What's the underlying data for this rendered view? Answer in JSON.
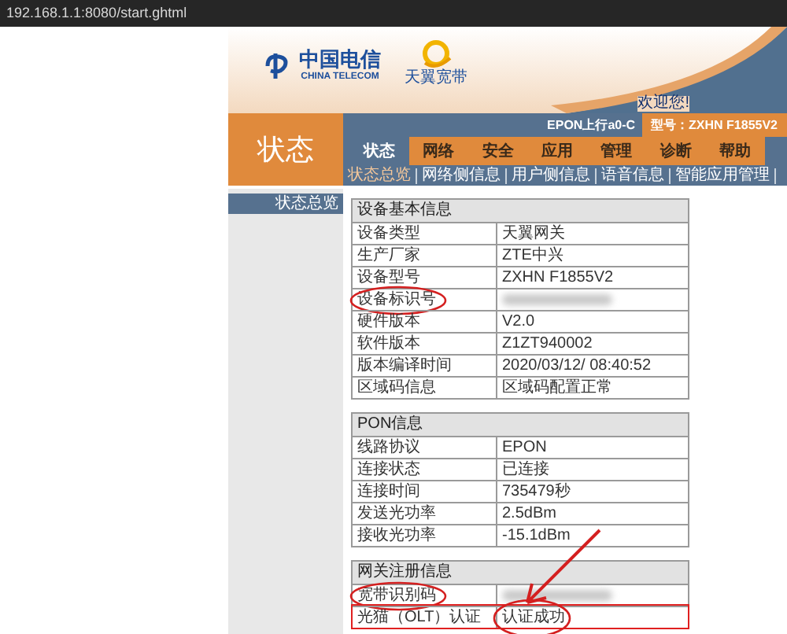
{
  "browser": {
    "url": "192.168.1.1:8080/start.ghtml"
  },
  "header": {
    "brand_cn": "中国电信",
    "brand_en": "CHINA TELECOM",
    "product": "天翼宽带",
    "welcome": "欢迎您!"
  },
  "page_title": "状态",
  "info_bar": {
    "uplink": "EPON上行a0-C",
    "model": "型号：ZXHN F1855V2"
  },
  "tabs": [
    {
      "label": "状态",
      "selected": true
    },
    {
      "label": "网络",
      "selected": false
    },
    {
      "label": "安全",
      "selected": false
    },
    {
      "label": "应用",
      "selected": false
    },
    {
      "label": "管理",
      "selected": false
    },
    {
      "label": "诊断",
      "selected": false
    },
    {
      "label": "帮助",
      "selected": false
    }
  ],
  "subnav": [
    {
      "label": "状态总览",
      "selected": true
    },
    {
      "label": "网络侧信息",
      "selected": false
    },
    {
      "label": "用户侧信息",
      "selected": false
    },
    {
      "label": "语音信息",
      "selected": false
    },
    {
      "label": "智能应用管理",
      "selected": false
    }
  ],
  "sidebar": {
    "items": [
      {
        "label": "状态总览",
        "selected": true
      }
    ]
  },
  "tables": [
    {
      "title": "设备基本信息",
      "rows": [
        {
          "kind": "text",
          "label": "设备类型",
          "value": "天翼网关",
          "label_circled": false,
          "value_circled": false,
          "boxed": false
        },
        {
          "kind": "text",
          "label": "生产厂家",
          "value": "ZTE中兴",
          "label_circled": false,
          "value_circled": false,
          "boxed": false
        },
        {
          "kind": "text",
          "label": "设备型号",
          "value": "ZXHN  F1855V2",
          "label_circled": false,
          "value_circled": false,
          "boxed": false
        },
        {
          "kind": "redacted",
          "label": "设备标识号",
          "label_circled": true,
          "value_circled": false,
          "boxed": false
        },
        {
          "kind": "text",
          "label": "硬件版本",
          "value": "V2.0",
          "label_circled": false,
          "value_circled": false,
          "boxed": false
        },
        {
          "kind": "text",
          "label": "软件版本",
          "value": "Z1ZT940002",
          "label_circled": false,
          "value_circled": false,
          "boxed": false
        },
        {
          "kind": "text",
          "label": "版本编译时间",
          "value": "2020/03/12/  08:40:52",
          "label_circled": false,
          "value_circled": false,
          "boxed": false
        },
        {
          "kind": "text",
          "label": "区域码信息",
          "value": "区域码配置正常",
          "label_circled": false,
          "value_circled": false,
          "boxed": false
        }
      ]
    },
    {
      "title": "PON信息",
      "rows": [
        {
          "kind": "text",
          "label": "线路协议",
          "value": "EPON",
          "label_circled": false,
          "value_circled": false,
          "boxed": false
        },
        {
          "kind": "text",
          "label": "连接状态",
          "value": "已连接",
          "label_circled": false,
          "value_circled": false,
          "boxed": false
        },
        {
          "kind": "text",
          "label": "连接时间",
          "value": "735479秒",
          "label_circled": false,
          "value_circled": false,
          "boxed": false
        },
        {
          "kind": "text",
          "label": "发送光功率",
          "value": "2.5dBm",
          "label_circled": false,
          "value_circled": false,
          "boxed": false
        },
        {
          "kind": "text",
          "label": "接收光功率",
          "value": "-15.1dBm",
          "label_circled": false,
          "value_circled": false,
          "boxed": false
        }
      ]
    },
    {
      "title": "网关注册信息",
      "rows": [
        {
          "kind": "redacted",
          "label": "宽带识别码",
          "label_circled": true,
          "value_circled": false,
          "boxed": false
        },
        {
          "kind": "text",
          "label": "光猫（OLT）认证",
          "value": "认证成功",
          "label_circled": false,
          "value_circled": true,
          "boxed": true
        }
      ]
    }
  ]
}
